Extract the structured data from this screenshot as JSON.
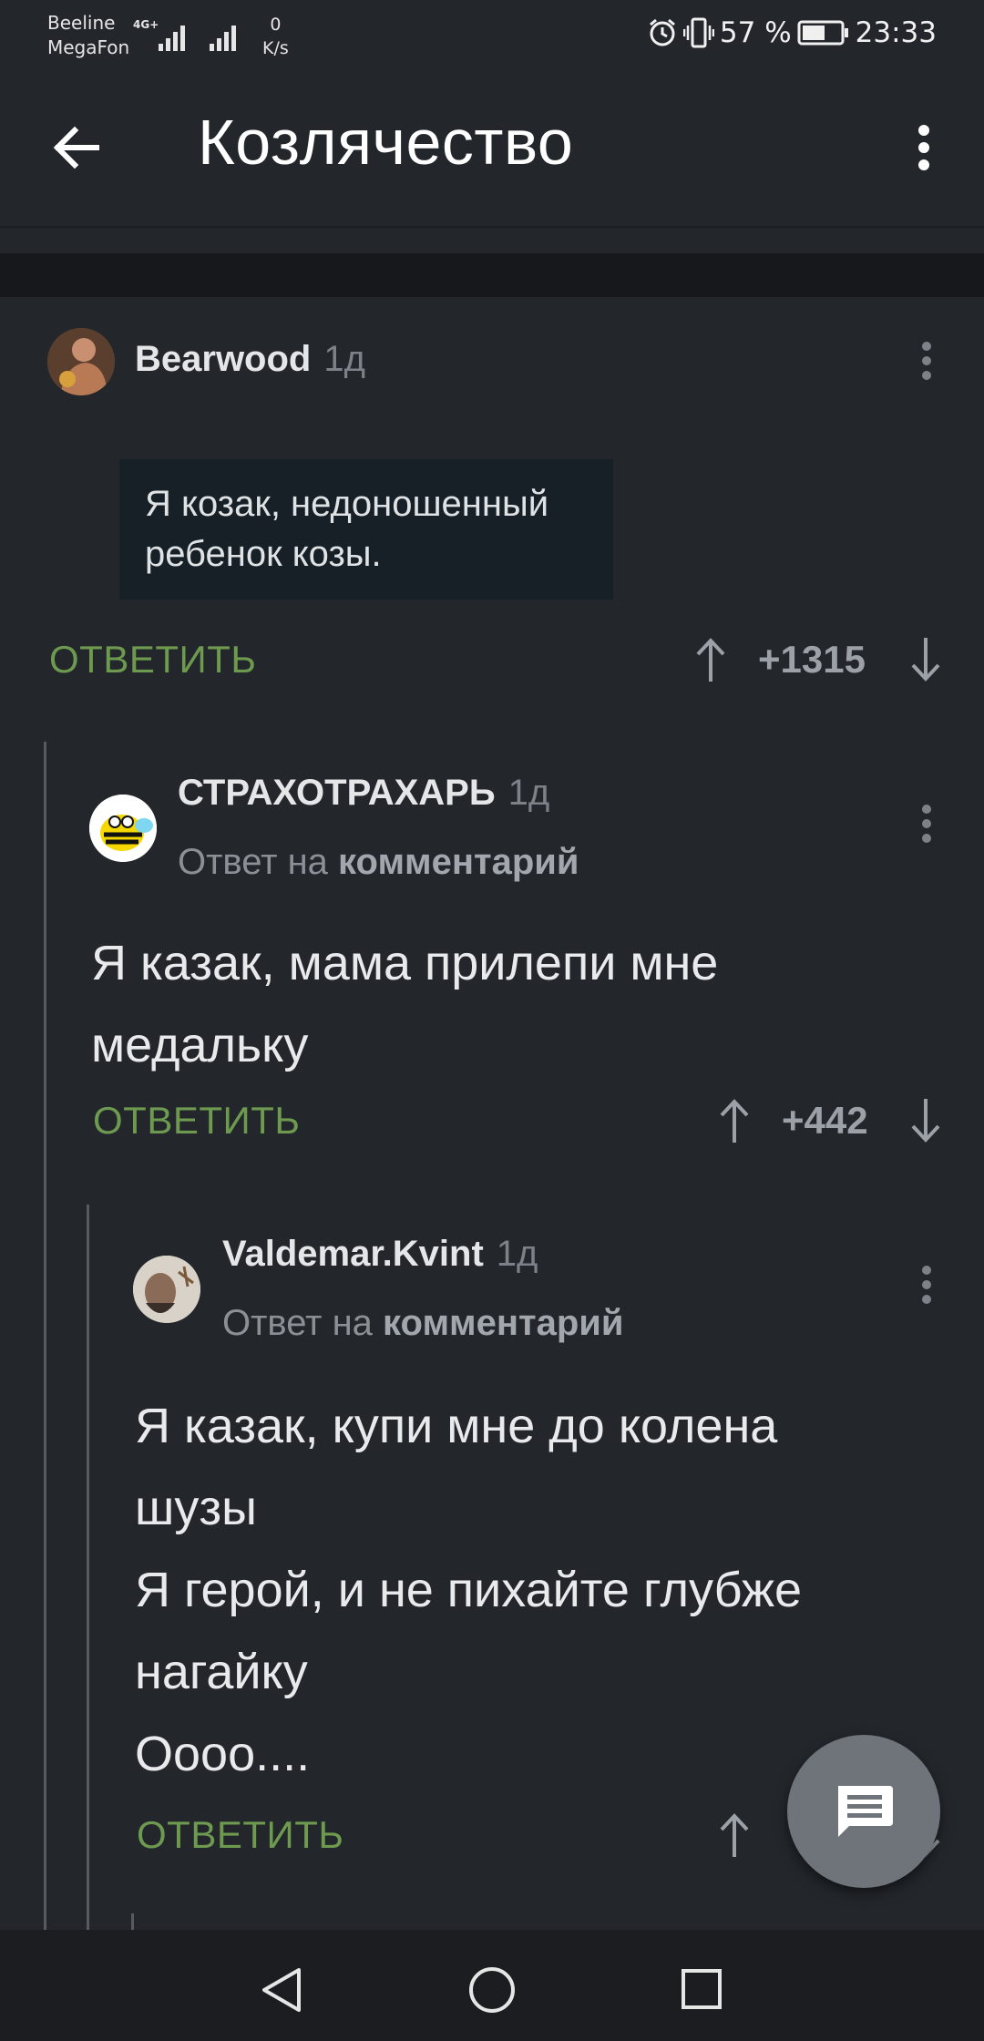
{
  "status_bar": {
    "carrier1": "Beeline",
    "carrier2": "MegaFon",
    "net": "4G+",
    "speed_value": "0",
    "speed_unit": "K/s",
    "battery": "57 %",
    "time": "23:33"
  },
  "toolbar": {
    "title": "Козлячество"
  },
  "comments": [
    {
      "author": "Bearwood",
      "time": "1д",
      "quote": "Я козак, недоношенный ребенок козы.",
      "reply_label": "ОТВЕТИТЬ",
      "score": "+1315"
    },
    {
      "author": "СТРАХОТРАХАРЬ",
      "time": "1д",
      "reply_to_prefix": "Ответ на",
      "reply_to_target": "комментарий",
      "text": "Я казак, мама прилепи мне медальку",
      "reply_label": "ОТВЕТИТЬ",
      "score": "+442"
    },
    {
      "author": "Valdemar.Kvint",
      "time": "1д",
      "reply_to_prefix": "Ответ на",
      "reply_to_target": "комментарий",
      "lines": [
        "Я казак, купи мне до колена шузы",
        "Я герой, и не пихайте глубже нагайку",
        "Оооо...."
      ],
      "reply_label": "ОТВЕТИТЬ"
    }
  ],
  "icons": {
    "back": "arrow-left-icon",
    "menu": "more-vertical-icon",
    "upvote": "arrow-up-icon",
    "downvote": "arrow-down-icon",
    "fab": "comment-icon",
    "nav_back": "triangle-back-icon",
    "nav_home": "circle-home-icon",
    "nav_recent": "square-recent-icon"
  },
  "colors": {
    "background": "#23272c",
    "reply_green": "#6d9a4f",
    "quote_bg": "#172026"
  }
}
